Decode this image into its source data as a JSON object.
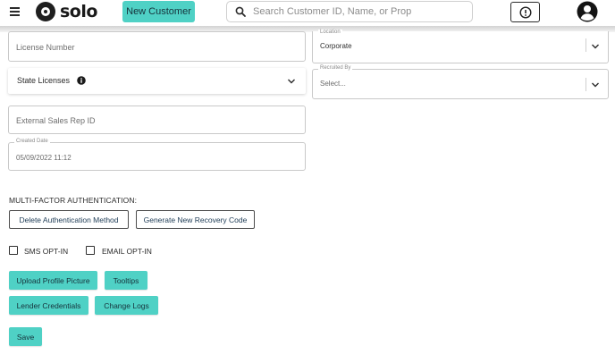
{
  "header": {
    "logo_text": "solo",
    "new_customer_label": "New Customer",
    "search_placeholder": "Search Customer ID, Name, or Prop"
  },
  "form": {
    "license_number_placeholder": "License Number",
    "location": {
      "label": "Location",
      "value": "Corporate"
    },
    "state_licenses_label": "State Licenses",
    "recruited_by": {
      "label": "Recruited By",
      "value": "Select..."
    },
    "external_sales_rep_placeholder": "External Sales Rep ID",
    "created_date": {
      "label": "Created Date",
      "value": "05/09/2022 11:12"
    }
  },
  "mfa": {
    "section_label": "MULTI-FACTOR AUTHENTICATION:",
    "delete_label": "Delete Authentication Method",
    "generate_label": "Generate New Recovery Code"
  },
  "opt_in": {
    "sms_label": "SMS OPT-IN",
    "email_label": "EMAIL OPT-IN"
  },
  "actions": {
    "upload_label": "Upload Profile Picture",
    "tooltips_label": "Tooltips",
    "lender_label": "Lender Credentials",
    "change_logs_label": "Change Logs",
    "save_label": "Save"
  },
  "icons": {
    "menu": "hamburger-menu-icon",
    "search": "search-icon",
    "alert": "exclamation-circle-icon",
    "avatar": "user-circle-icon",
    "chevron": "chevron-down-icon",
    "info": "info-circle-icon"
  },
  "colors": {
    "accent": "#4fd1c5",
    "text": "#2b2b2b",
    "border": "#c9c9c9"
  }
}
